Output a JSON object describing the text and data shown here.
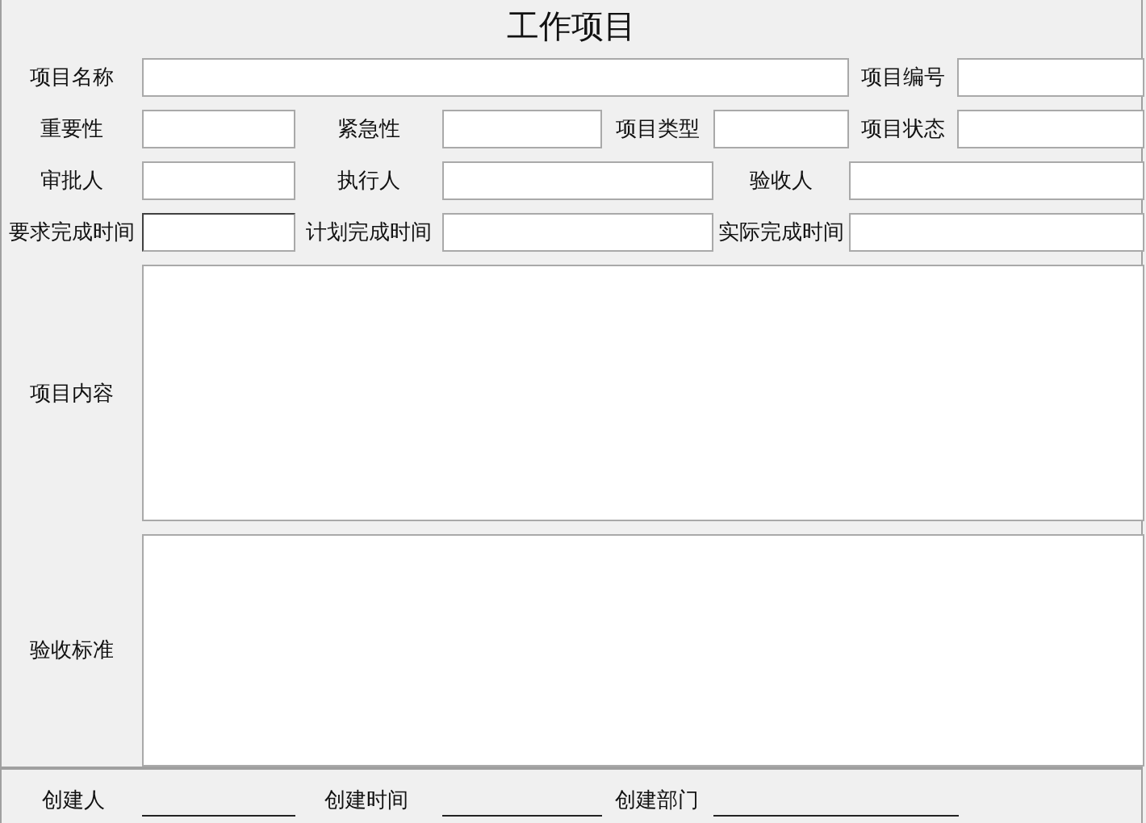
{
  "title": "工作项目",
  "fields": [
    {
      "label": "项目名称",
      "focused": false
    },
    {
      "label": "项目编号",
      "focused": false
    },
    {
      "label": "重要性",
      "focused": false
    },
    {
      "label": "紧急性",
      "focused": false
    },
    {
      "label": "项目类型",
      "focused": false
    },
    {
      "label": "项目状态",
      "focused": false
    },
    {
      "label": "审批人",
      "focused": false
    },
    {
      "label": "执行人",
      "focused": false
    },
    {
      "label": "验收人",
      "focused": false
    },
    {
      "label": "要求完成时间",
      "focused": true
    },
    {
      "label": "计划完成时间",
      "focused": false
    },
    {
      "label": "实际完成时间",
      "focused": false
    }
  ],
  "text_areas": [
    {
      "label": "项目内容"
    },
    {
      "label": "验收标准"
    }
  ],
  "footer": [
    {
      "label": "创建人"
    },
    {
      "label": "创建时间"
    },
    {
      "label": "创建部门"
    }
  ]
}
